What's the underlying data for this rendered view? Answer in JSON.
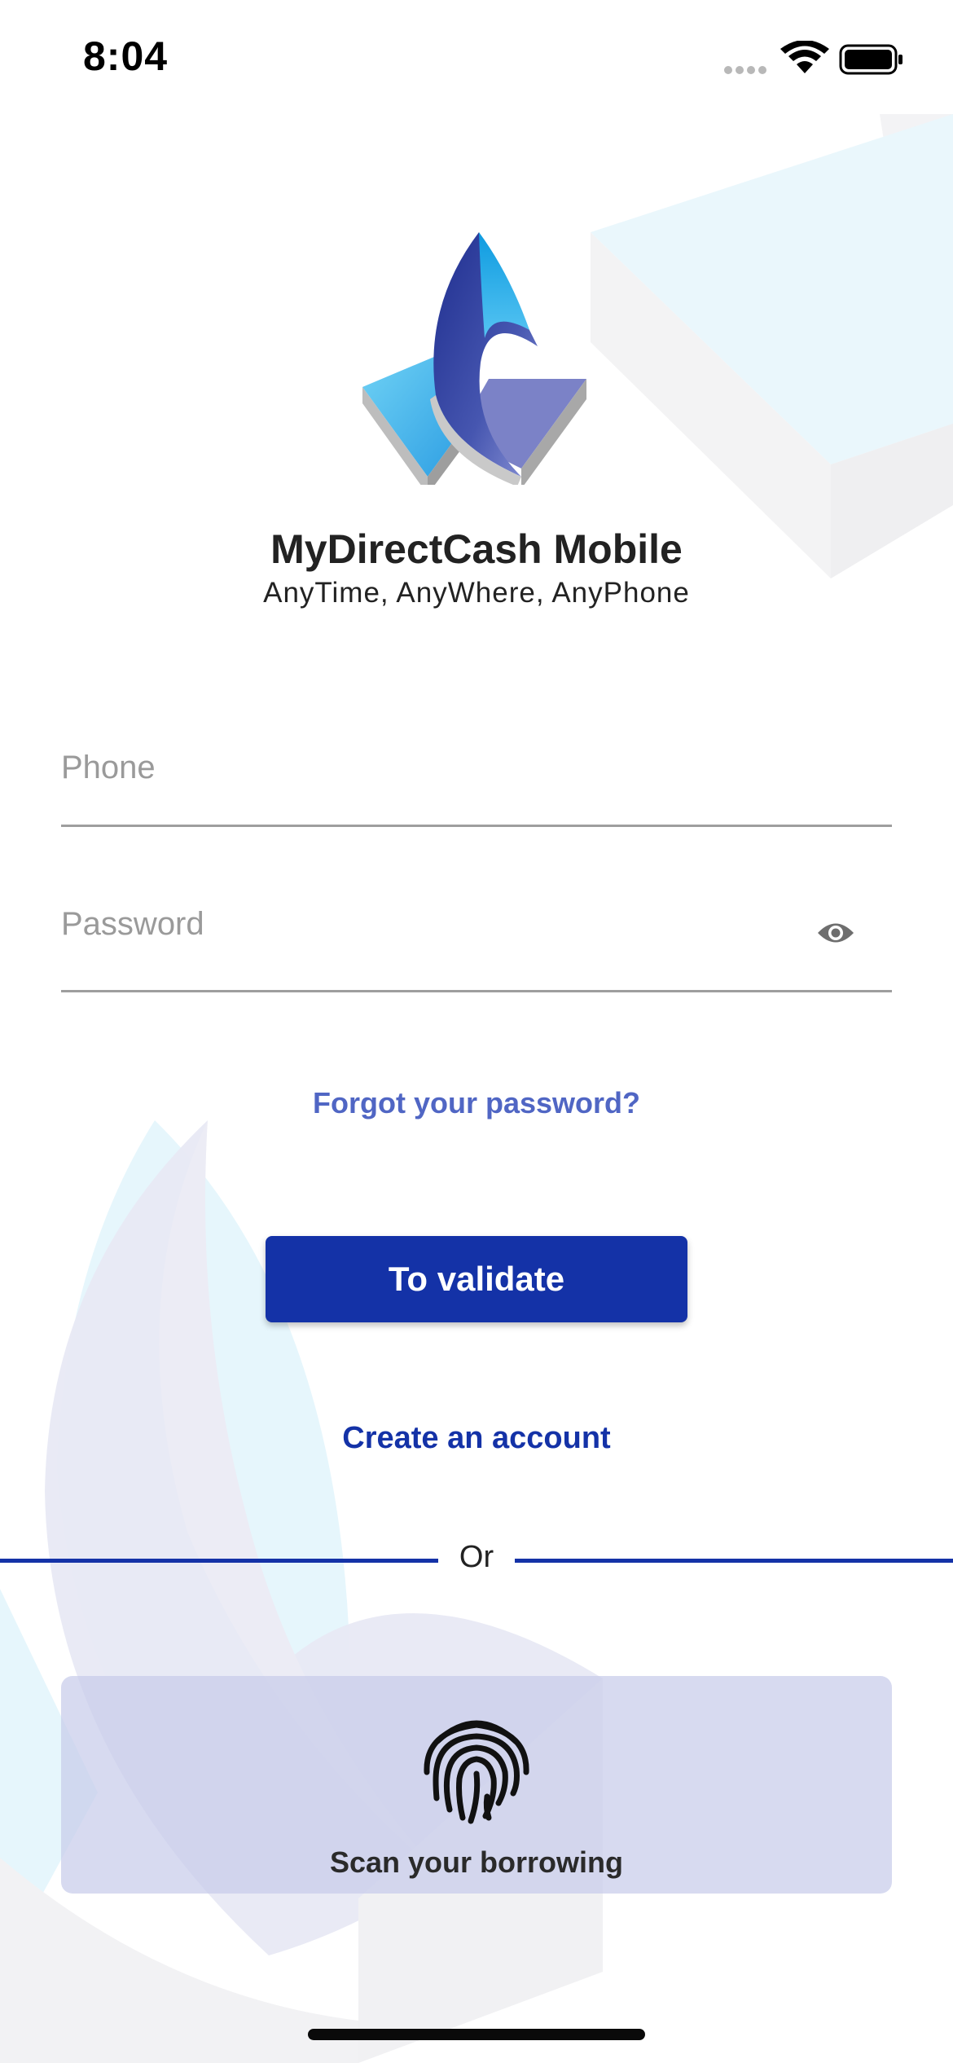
{
  "status_bar": {
    "time": "8:04",
    "icons": [
      "signal-dots-icon",
      "wifi-icon",
      "battery-icon"
    ]
  },
  "app": {
    "logo_icon": "mydirectcash-logo",
    "title": "MyDirectCash Mobile",
    "subtitle": "AnyTime, AnyWhere, AnyPhone"
  },
  "form": {
    "phone_placeholder": "Phone",
    "phone_value": "",
    "password_placeholder": "Password",
    "password_value": "",
    "password_toggle_icon": "eye-icon",
    "forgot_password": "Forgot your password?",
    "validate_label": "To validate",
    "create_account": "Create an account"
  },
  "divider": {
    "label": "Or"
  },
  "biometric": {
    "icon": "fingerprint-icon",
    "label": "Scan your borrowing"
  },
  "colors": {
    "primary": "#1432a7",
    "link": "#5066c4",
    "card_bg": "#d3d6ee",
    "divider": "#1432a7"
  }
}
